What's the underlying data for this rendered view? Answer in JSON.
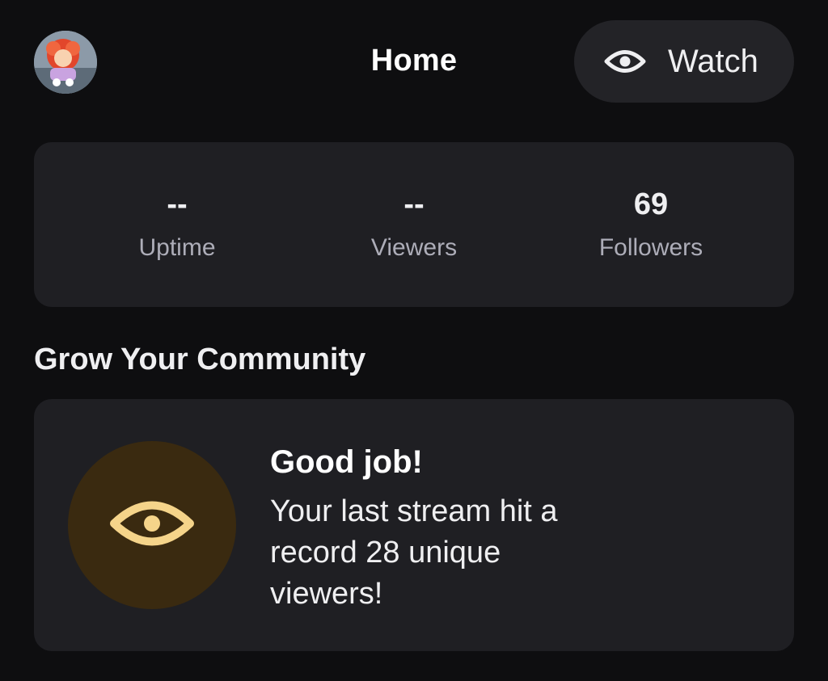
{
  "header": {
    "title": "Home",
    "watch_label": "Watch"
  },
  "stats": [
    {
      "value": "--",
      "label": "Uptime"
    },
    {
      "value": "--",
      "label": "Viewers"
    },
    {
      "value": "69",
      "label": "Followers"
    }
  ],
  "section": {
    "title": "Grow Your Community"
  },
  "achievement": {
    "title": "Good job!",
    "message": "Your last stream hit a record 28 unique viewers!"
  },
  "colors": {
    "background": "#0e0e10",
    "card": "#1f1f23",
    "button": "#232327",
    "badge_bg": "#3a2a10",
    "badge_icon": "#f5d48a",
    "muted_text": "#adadb8"
  }
}
